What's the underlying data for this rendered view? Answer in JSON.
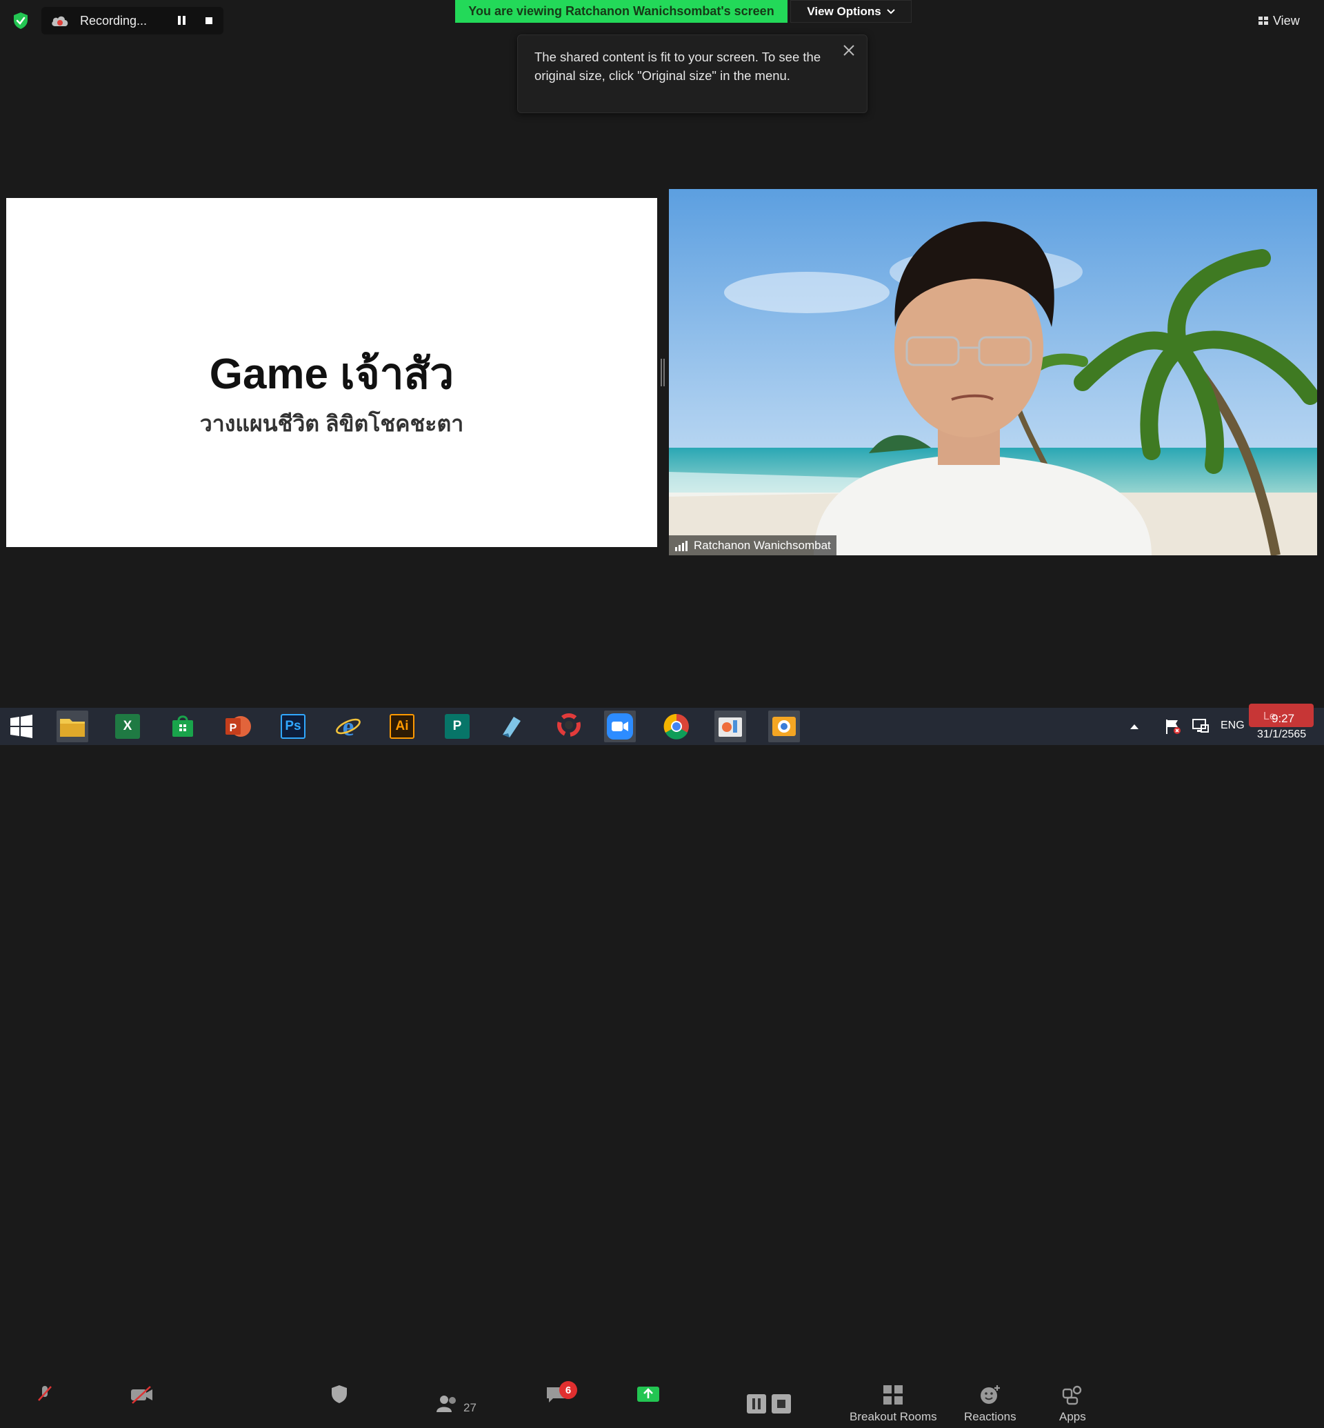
{
  "recording": {
    "label": "Recording..."
  },
  "banner": {
    "text": "You are viewing Ratchanon Wanichsombat's screen"
  },
  "view_options": {
    "label": "View Options"
  },
  "view_button": {
    "label": "View"
  },
  "tooltip": {
    "text": "The shared content is fit to your screen. To see the original size, click \"Original size\" in the menu."
  },
  "slide": {
    "title": "Game เจ้าสัว",
    "subtitle": "วางแผนชีวิต ลิขิตโชคชะตา"
  },
  "video": {
    "participant_name": "Ratchanon Wanichsombat"
  },
  "controls": {
    "participants_count": "27",
    "chat_badge": "6",
    "breakout_rooms": "Breakout Rooms",
    "reactions": "Reactions",
    "apps": "Apps"
  },
  "taskbar": {
    "apps": [
      "start-icon",
      "file-explorer-icon",
      "excel-icon",
      "store-icon",
      "powerpoint-icon",
      "photoshop-icon",
      "internet-explorer-icon",
      "illustrator-icon",
      "publisher-icon",
      "edge-legacy-icon",
      "photoscape-icon",
      "zoom-icon",
      "chrome-icon",
      "paint-icon",
      "snip-icon"
    ],
    "app_labels": {
      "excel": "X",
      "photoshop": "Ps",
      "illustrator": "Ai",
      "publisher": "P"
    },
    "language": "ENG",
    "leave_label": "Le",
    "time": "9:27",
    "date": "31/1/2565"
  },
  "colors": {
    "banner_green": "#23d959",
    "leave_red": "#c73636",
    "background": "#1a1a1a"
  }
}
